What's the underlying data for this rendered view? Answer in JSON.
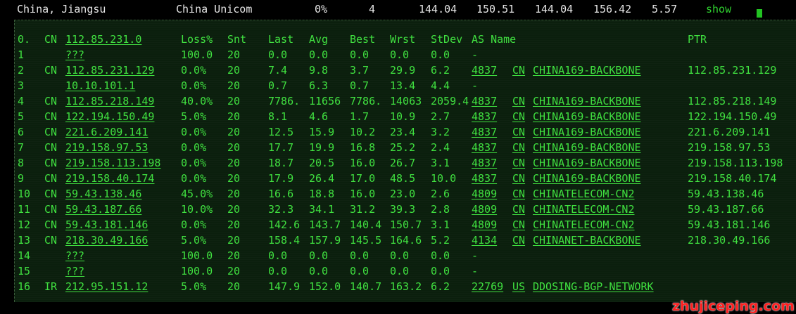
{
  "summary": {
    "location": "China, Jiangsu",
    "isp": "China Unicom",
    "loss": "0%",
    "sent": "4",
    "v1": "144.04",
    "v2": "150.51",
    "v3": "144.04",
    "v4": "156.42",
    "v5": "5.57",
    "show_label": "show"
  },
  "header": {
    "hop": "0.",
    "cc": "CN",
    "ip": "112.85.231.0",
    "loss": "Loss%",
    "snt": "Snt",
    "last": "Last",
    "avg": "Avg",
    "best": "Best",
    "wrst": "Wrst",
    "stdev": "StDev",
    "as_name": "AS Name",
    "ptr": "PTR"
  },
  "hops": [
    {
      "hop": "1",
      "cc": "",
      "ip": "???",
      "loss": "100.0",
      "snt": "20",
      "last": "0.0",
      "avg": "0.0",
      "best": "0.0",
      "wrst": "0.0",
      "stdev": "0.0",
      "asn": "-",
      "as_cc": "",
      "as_name": "",
      "ptr": ""
    },
    {
      "hop": "2",
      "cc": "CN",
      "ip": "112.85.231.129",
      "loss": "0.0%",
      "snt": "20",
      "last": "7.4",
      "avg": "9.8",
      "best": "3.7",
      "wrst": "29.9",
      "stdev": "6.2",
      "asn": "4837",
      "as_cc": "CN",
      "as_name": "CHINA169-BACKBONE",
      "ptr": "112.85.231.129"
    },
    {
      "hop": "3",
      "cc": "",
      "ip": "10.10.101.1",
      "loss": "0.0%",
      "snt": "20",
      "last": "0.7",
      "avg": "6.3",
      "best": "0.7",
      "wrst": "13.4",
      "stdev": "4.4",
      "asn": "-",
      "as_cc": "",
      "as_name": "",
      "ptr": ""
    },
    {
      "hop": "4",
      "cc": "CN",
      "ip": "112.85.218.149",
      "loss": "40.0%",
      "snt": "20",
      "last": "7786.",
      "avg": "11656",
      "best": "7786.",
      "wrst": "14063",
      "stdev": "2059.4",
      "asn": "4837",
      "as_cc": "CN",
      "as_name": "CHINA169-BACKBONE",
      "ptr": "112.85.218.149"
    },
    {
      "hop": "5",
      "cc": "CN",
      "ip": "122.194.150.49",
      "loss": "5.0%",
      "snt": "20",
      "last": "8.1",
      "avg": "4.6",
      "best": "1.7",
      "wrst": "10.9",
      "stdev": "2.7",
      "asn": "4837",
      "as_cc": "CN",
      "as_name": "CHINA169-BACKBONE",
      "ptr": "122.194.150.49"
    },
    {
      "hop": "6",
      "cc": "CN",
      "ip": "221.6.209.141",
      "loss": "0.0%",
      "snt": "20",
      "last": "12.5",
      "avg": "15.9",
      "best": "10.2",
      "wrst": "23.4",
      "stdev": "3.2",
      "asn": "4837",
      "as_cc": "CN",
      "as_name": "CHINA169-BACKBONE",
      "ptr": "221.6.209.141"
    },
    {
      "hop": "7",
      "cc": "CN",
      "ip": "219.158.97.53",
      "loss": "0.0%",
      "snt": "20",
      "last": "17.7",
      "avg": "19.9",
      "best": "16.8",
      "wrst": "25.2",
      "stdev": "2.4",
      "asn": "4837",
      "as_cc": "CN",
      "as_name": "CHINA169-BACKBONE",
      "ptr": "219.158.97.53"
    },
    {
      "hop": "8",
      "cc": "CN",
      "ip": "219.158.113.198",
      "loss": "0.0%",
      "snt": "20",
      "last": "18.7",
      "avg": "20.5",
      "best": "16.0",
      "wrst": "26.7",
      "stdev": "3.1",
      "asn": "4837",
      "as_cc": "CN",
      "as_name": "CHINA169-BACKBONE",
      "ptr": "219.158.113.198"
    },
    {
      "hop": "9",
      "cc": "CN",
      "ip": "219.158.40.174",
      "loss": "0.0%",
      "snt": "20",
      "last": "17.9",
      "avg": "26.4",
      "best": "17.0",
      "wrst": "48.5",
      "stdev": "10.0",
      "asn": "4837",
      "as_cc": "CN",
      "as_name": "CHINA169-BACKBONE",
      "ptr": "219.158.40.174"
    },
    {
      "hop": "10",
      "cc": "CN",
      "ip": "59.43.138.46",
      "loss": "45.0%",
      "snt": "20",
      "last": "16.6",
      "avg": "18.8",
      "best": "16.0",
      "wrst": "23.0",
      "stdev": "2.6",
      "asn": "4809",
      "as_cc": "CN",
      "as_name": "CHINATELECOM-CN2",
      "ptr": "59.43.138.46"
    },
    {
      "hop": "11",
      "cc": "CN",
      "ip": "59.43.187.66",
      "loss": "10.0%",
      "snt": "20",
      "last": "32.3",
      "avg": "34.1",
      "best": "31.2",
      "wrst": "39.3",
      "stdev": "2.8",
      "asn": "4809",
      "as_cc": "CN",
      "as_name": "CHINATELECOM-CN2",
      "ptr": "59.43.187.66"
    },
    {
      "hop": "12",
      "cc": "CN",
      "ip": "59.43.181.146",
      "loss": "0.0%",
      "snt": "20",
      "last": "142.6",
      "avg": "143.7",
      "best": "140.4",
      "wrst": "150.7",
      "stdev": "3.1",
      "asn": "4809",
      "as_cc": "CN",
      "as_name": "CHINATELECOM-CN2",
      "ptr": "59.43.181.146"
    },
    {
      "hop": "13",
      "cc": "CN",
      "ip": "218.30.49.166",
      "loss": "5.0%",
      "snt": "20",
      "last": "158.4",
      "avg": "157.9",
      "best": "145.5",
      "wrst": "164.6",
      "stdev": "5.2",
      "asn": "4134",
      "as_cc": "CN",
      "as_name": "CHINANET-BACKBONE",
      "ptr": "218.30.49.166"
    },
    {
      "hop": "14",
      "cc": "",
      "ip": "???",
      "loss": "100.0",
      "snt": "20",
      "last": "0.0",
      "avg": "0.0",
      "best": "0.0",
      "wrst": "0.0",
      "stdev": "0.0",
      "asn": "-",
      "as_cc": "",
      "as_name": "",
      "ptr": ""
    },
    {
      "hop": "15",
      "cc": "",
      "ip": "???",
      "loss": "100.0",
      "snt": "20",
      "last": "0.0",
      "avg": "0.0",
      "best": "0.0",
      "wrst": "0.0",
      "stdev": "0.0",
      "asn": "-",
      "as_cc": "",
      "as_name": "",
      "ptr": ""
    },
    {
      "hop": "16",
      "cc": "IR",
      "ip": "212.95.151.12",
      "loss": "5.0%",
      "snt": "20",
      "last": "147.9",
      "avg": "152.0",
      "best": "140.7",
      "wrst": "163.2",
      "stdev": "6.2",
      "asn": "22769",
      "as_cc": "US",
      "as_name": "DDOSING-BGP-NETWORK",
      "ptr": ""
    }
  ],
  "watermark": "zhujiceping.com",
  "colors": {
    "terminal_green": "#3fe03f",
    "panel_bg": "#0b1f0d",
    "watermark": "#ff2020"
  }
}
